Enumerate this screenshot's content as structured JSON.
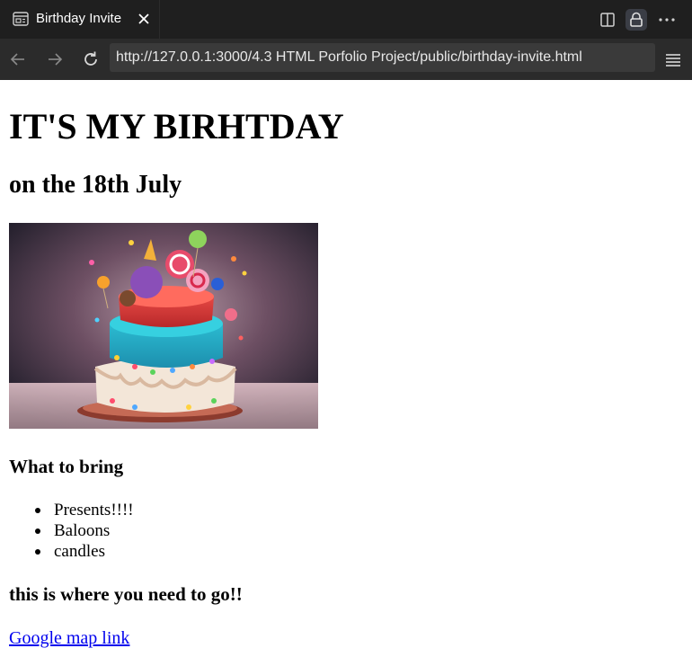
{
  "browser": {
    "tab_title": "Birthday Invite",
    "url": "http://127.0.0.1:3000/4.3 HTML Porfolio Project/public/birthday-invite.html",
    "icons": [
      "page-icon",
      "close-icon",
      "split-view-icon",
      "lock-icon",
      "more-icon",
      "back-icon",
      "forward-icon",
      "reload-icon",
      "menu-icon"
    ]
  },
  "page": {
    "heading": "IT'S MY BIRHTDAY",
    "subheading": "on the 18th July",
    "image": "birthday-cake-photo",
    "bring_heading": "What to bring",
    "bring_items": [
      "Presents!!!!",
      "Baloons",
      "candles"
    ],
    "where_heading": "this is where you need to go!!",
    "map_link": "Google map link"
  },
  "colors": {
    "chrome_dark": "#1f1f1f",
    "addressbar": "#2b2b2b",
    "link": "#0000ee"
  }
}
